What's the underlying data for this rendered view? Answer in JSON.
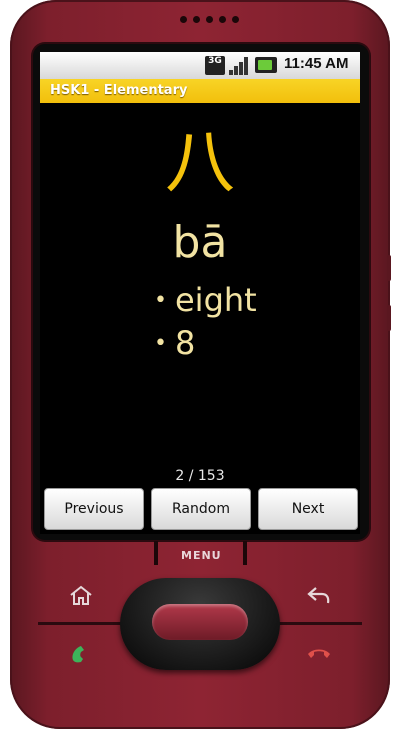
{
  "statusbar": {
    "network": "3G",
    "time": "11:45 AM"
  },
  "app": {
    "title": "HSK1 - Elementary"
  },
  "card": {
    "hanzi": "八",
    "pinyin": "bā",
    "meanings": [
      "eight",
      "8"
    ]
  },
  "progress": {
    "counter": "2 / 153",
    "current": 2,
    "total": 153
  },
  "buttons": {
    "previous": "Previous",
    "random": "Random",
    "next": "Next"
  },
  "device": {
    "menu_label": "MENU",
    "icons": [
      "home-icon",
      "back-icon",
      "call-icon",
      "end-call-icon"
    ]
  },
  "colors": {
    "titlebar": "#f5c811",
    "hanzi": "#f5c20c",
    "text": "#f2e3a3",
    "phone_body": "#8e2433"
  }
}
